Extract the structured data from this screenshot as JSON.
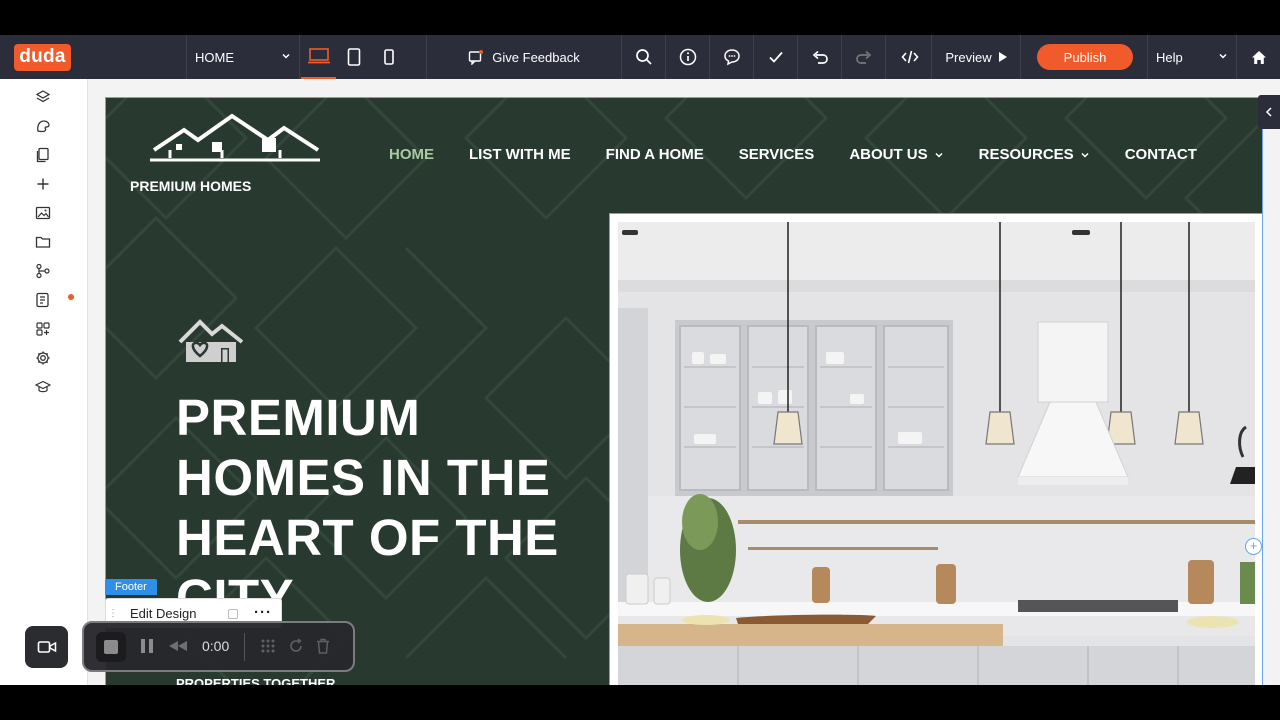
{
  "app": {
    "logo": "duda"
  },
  "toolbar": {
    "page_select": "HOME",
    "feedback_label": "Give Feedback",
    "preview_label": "Preview",
    "publish_label": "Publish",
    "help_label": "Help"
  },
  "site": {
    "brand_name": "PREMIUM HOMES",
    "nav": [
      {
        "label": "HOME"
      },
      {
        "label": "LIST WITH ME"
      },
      {
        "label": "FIND A HOME"
      },
      {
        "label": "SERVICES"
      },
      {
        "label": "ABOUT US"
      },
      {
        "label": "RESOURCES"
      },
      {
        "label": "CONTACT"
      }
    ],
    "hero_title_lines": [
      "PREMIUM",
      "HOMES IN THE",
      "HEART OF THE",
      "CITY"
    ],
    "hero_sub": "PROPERTIES TOGETHER"
  },
  "editor": {
    "footer_badge": "Footer",
    "edit_design": "Edit Design"
  },
  "recorder": {
    "time": "0:00"
  },
  "colors": {
    "accent": "#f15a2b",
    "site_bg": "#283a30",
    "nav_active": "#a9cba0",
    "toolbar_bg": "#2b2d3a"
  }
}
